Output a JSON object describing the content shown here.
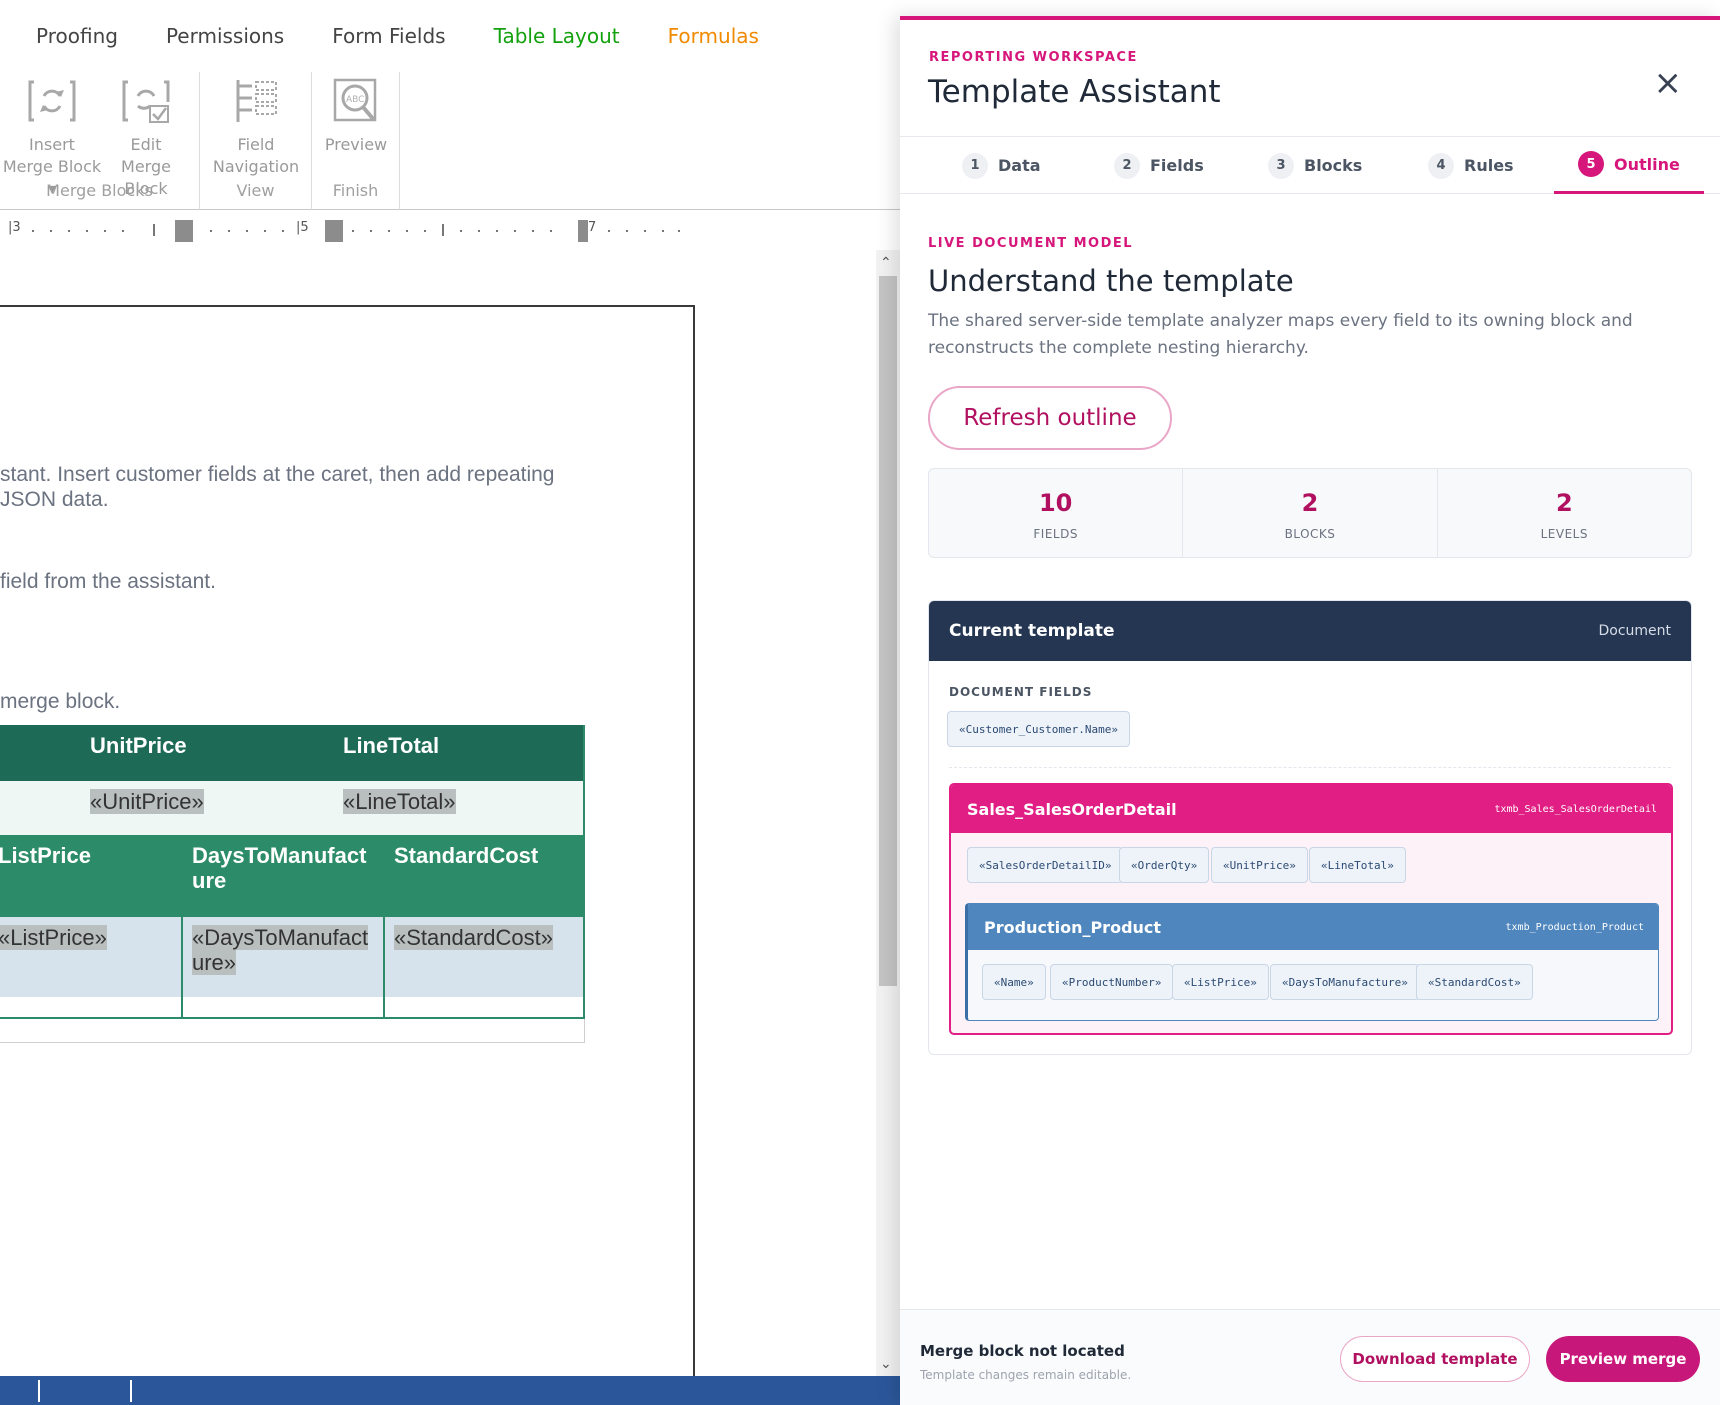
{
  "editor": {
    "menu_tabs": [
      "Proofing",
      "Permissions",
      "Form Fields",
      "Table Layout",
      "Formulas"
    ],
    "ribbon": {
      "insert_merge_block": "Insert Merge Block ▾",
      "edit_merge_block": "Edit Merge Block",
      "merge_blocks_group": "Merge Blocks",
      "field_navigation": "Field Navigation",
      "view_group": "View",
      "preview": "Preview",
      "finish_group": "Finish"
    },
    "ruler": {
      "labels": [
        "3",
        "5",
        "7"
      ]
    },
    "body": {
      "para1_line1": "stant. Insert customer fields at the caret, then add repeating",
      "para1_line2": " JSON data.",
      "para2": "field from the assistant.",
      "para3": "merge block."
    },
    "table": {
      "header1": [
        "UnitPrice",
        "LineTotal"
      ],
      "row1": [
        "«UnitPrice»",
        "«LineTotal»"
      ],
      "header2": [
        "ListPrice",
        "DaysToManufact ure",
        "StandardCost"
      ],
      "row2": [
        "«ListPrice»",
        "«DaysToManufact ure»",
        "«StandardCost»"
      ]
    }
  },
  "panel": {
    "eyebrow": "REPORTING WORKSPACE",
    "title": "Template Assistant",
    "close_icon": "×",
    "steps": [
      {
        "num": "1",
        "label": "Data"
      },
      {
        "num": "2",
        "label": "Fields"
      },
      {
        "num": "3",
        "label": "Blocks"
      },
      {
        "num": "4",
        "label": "Rules"
      },
      {
        "num": "5",
        "label": "Outline"
      }
    ],
    "active_step": "Outline",
    "section_eyebrow": "LIVE DOCUMENT MODEL",
    "section_title": "Understand the template",
    "section_desc": "The shared server-side template analyzer maps every field to its owning block and reconstructs the complete nesting hierarchy.",
    "refresh_label": "Refresh outline",
    "stats": [
      {
        "value": "10",
        "label": "FIELDS"
      },
      {
        "value": "2",
        "label": "BLOCKS"
      },
      {
        "value": "2",
        "label": "LEVELS"
      }
    ],
    "template_card": {
      "title": "Current template",
      "kind": "Document",
      "document_fields_label": "DOCUMENT FIELDS",
      "document_fields": [
        "«Customer_Customer.Name»"
      ],
      "block": {
        "name": "Sales_SalesOrderDetail",
        "id": "txmb_Sales_SalesOrderDetail",
        "fields": [
          "«SalesOrderDetailID»",
          "«OrderQty»",
          "«UnitPrice»",
          "«LineTotal»"
        ],
        "child": {
          "name": "Production_Product",
          "id": "txmb_Production_Product",
          "fields": [
            "«Name»",
            "«ProductNumber»",
            "«ListPrice»",
            "«DaysToManufacture»",
            "«StandardCost»"
          ]
        }
      }
    },
    "footer": {
      "status_title": "Merge block not located",
      "status_sub": "Template changes remain editable.",
      "download_label": "Download template",
      "preview_label": "Preview merge"
    },
    "colors": {
      "accent": "#d6167a",
      "navy": "#243652",
      "block_blue": "#4f86bd"
    }
  }
}
